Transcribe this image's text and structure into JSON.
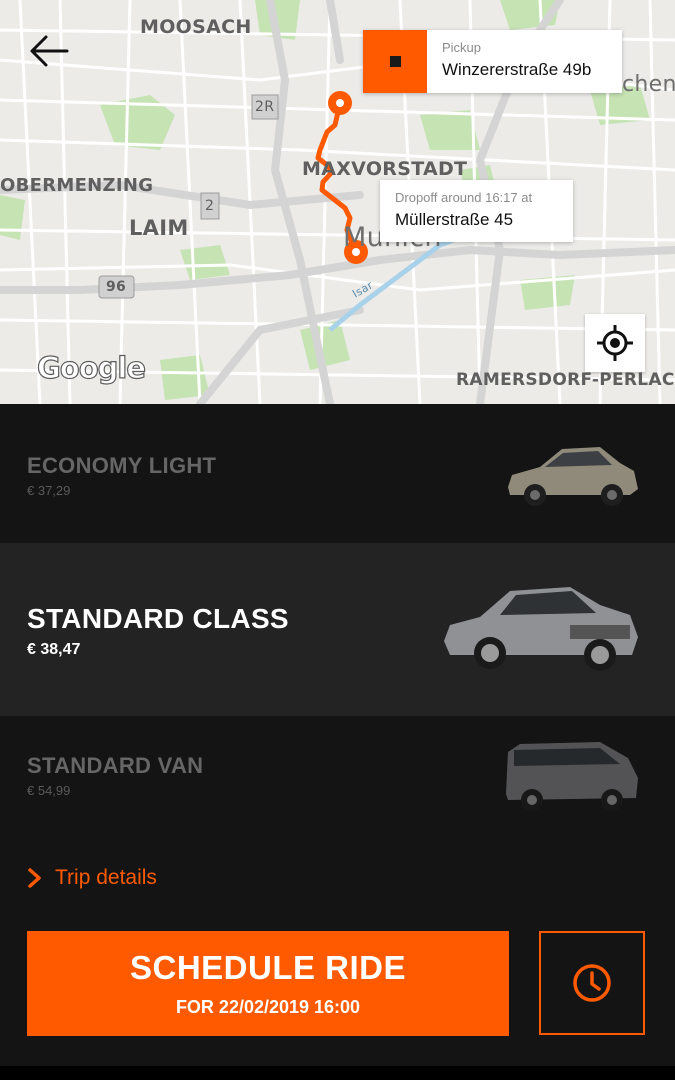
{
  "map": {
    "districts": [
      "MOOSACH",
      "MAXVORSTADT",
      "OBERMENZING",
      "LAIM",
      "Munich",
      "RAMERSDORF-PERLACH",
      "chen"
    ],
    "road_badges": [
      "2R",
      "2",
      "96"
    ],
    "river_label": "Isar",
    "attribution": "Google",
    "pickup": {
      "label": "Pickup",
      "address": "Winzererstraße 49b"
    },
    "dropoff": {
      "label": "Dropoff around 16:17 at",
      "address": "Müllerstraße 45"
    },
    "icons": {
      "back": "arrow-left-icon",
      "locate": "crosshair-icon"
    },
    "route_color": "#ff5a00"
  },
  "vehicles": [
    {
      "name": "ECONOMY LIGHT",
      "price": "€ 37,29",
      "selected": false,
      "image": "toyota-prius-icon"
    },
    {
      "name": "STANDARD CLASS",
      "price": "€ 38,47",
      "selected": true,
      "image": "vw-passat-icon"
    },
    {
      "name": "STANDARD VAN",
      "price": "€ 54,99",
      "selected": false,
      "image": "vw-van-icon"
    }
  ],
  "trip_details": {
    "label": "Trip details",
    "icon": "chevron-right-icon"
  },
  "schedule": {
    "title": "SCHEDULE RIDE",
    "subtitle": "FOR 22/02/2019 16:00"
  },
  "time_button": {
    "icon": "clock-icon"
  },
  "colors": {
    "accent": "#ff5a00",
    "background": "#141414",
    "selected_row": "#232323"
  }
}
